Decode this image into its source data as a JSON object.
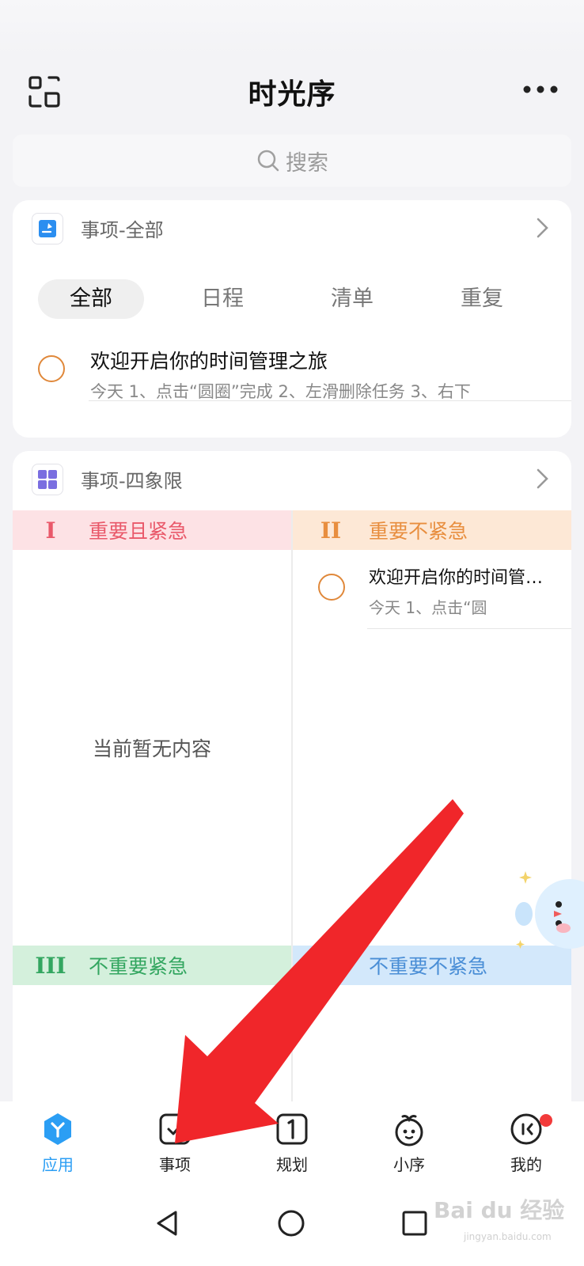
{
  "header": {
    "title": "时光序",
    "left_icon": "scan-icon",
    "right_icon": "more-icon"
  },
  "search": {
    "placeholder": "搜索"
  },
  "card_all": {
    "title": "事项-全部",
    "tabs": [
      "全部",
      "日程",
      "清单",
      "重复"
    ],
    "active_tab": "全部",
    "task": {
      "title": "欢迎开启你的时间管理之旅",
      "subtitle": "今天 1、点击“圆圈”完成 2、左滑删除任务 3、右下"
    }
  },
  "card_quad": {
    "title": "事项-四象限",
    "quadrants": [
      {
        "roman": "I",
        "label": "重要且紧急",
        "color": "#e9596a"
      },
      {
        "roman": "II",
        "label": "重要不紧急",
        "color": "#e88e3f"
      },
      {
        "roman": "III",
        "label": "不重要紧急",
        "color": "#33a660"
      },
      {
        "roman": "IV",
        "label": "不重要不紧急",
        "color": "#4a8ed6"
      }
    ],
    "empty_text": "当前暂无内容",
    "q2_task": {
      "title": "欢迎开启你的时间管理之旅",
      "subtitle": "今天 1、点击“圆"
    }
  },
  "bottom_nav": [
    {
      "label": "应用",
      "icon": "app-hub-icon",
      "active": true
    },
    {
      "label": "事项",
      "icon": "checkbox-icon",
      "active": false
    },
    {
      "label": "规划",
      "icon": "calendar-one-icon",
      "active": false
    },
    {
      "label": "小序",
      "icon": "mascot-face-icon",
      "active": false
    },
    {
      "label": "我的",
      "icon": "profile-face-icon",
      "active": false,
      "badge": true
    }
  ],
  "watermark": {
    "text": "Bai du 经验",
    "sub": "jingyan.baidu.com"
  },
  "colors": {
    "accent": "#2b9ef4",
    "arrow": "#f0262a",
    "task_circle": "#e0883a"
  }
}
